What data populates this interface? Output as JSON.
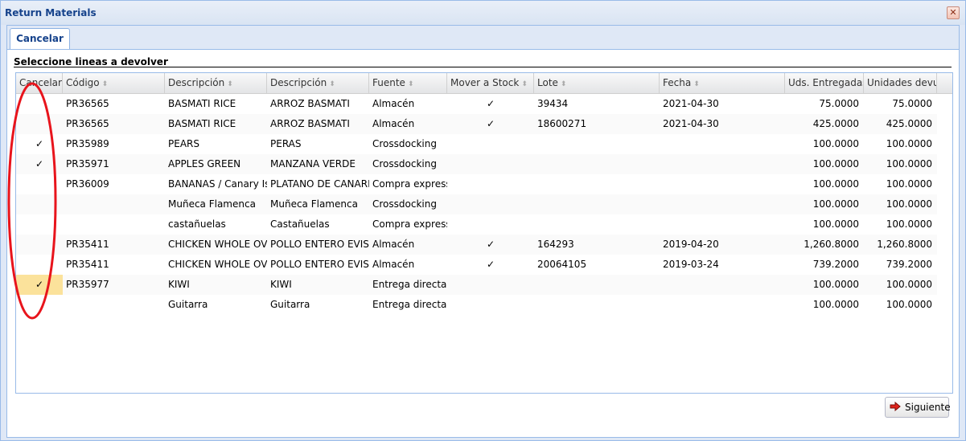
{
  "window": {
    "title": "Return Materials",
    "close_glyph": "✕"
  },
  "tabs": [
    {
      "label": "Cancelar"
    }
  ],
  "section": {
    "label": "Seleccione lineas a devolver"
  },
  "grid": {
    "columns": [
      {
        "label": "Cancelar"
      },
      {
        "label": "Código"
      },
      {
        "label": "Descripción"
      },
      {
        "label": "Descripción"
      },
      {
        "label": "Fuente"
      },
      {
        "label": "Mover a Stock"
      },
      {
        "label": "Lote"
      },
      {
        "label": "Fecha"
      },
      {
        "label": "Uds. Entregadas"
      },
      {
        "label": "Unidades devuel"
      }
    ],
    "rows": [
      {
        "cancel": "",
        "selected": false,
        "code": "PR36565",
        "desc_en": "BASMATI RICE",
        "desc_es": "ARROZ BASMATI",
        "source": "Almacén",
        "move_to_stock": "✓",
        "lot": "39434",
        "date": "2021-04-30",
        "delivered": "75.0000",
        "returned": "75.0000"
      },
      {
        "cancel": "",
        "selected": false,
        "code": "PR36565",
        "desc_en": "BASMATI RICE",
        "desc_es": "ARROZ BASMATI",
        "source": "Almacén",
        "move_to_stock": "✓",
        "lot": "18600271",
        "date": "2021-04-30",
        "delivered": "425.0000",
        "returned": "425.0000"
      },
      {
        "cancel": "✓",
        "selected": false,
        "code": "PR35989",
        "desc_en": "PEARS",
        "desc_es": "PERAS",
        "source": "Crossdocking",
        "move_to_stock": "",
        "lot": "",
        "date": "",
        "delivered": "100.0000",
        "returned": "100.0000"
      },
      {
        "cancel": "✓",
        "selected": false,
        "code": "PR35971",
        "desc_en": "APPLES GREEN",
        "desc_es": "MANZANA VERDE",
        "source": "Crossdocking",
        "move_to_stock": "",
        "lot": "",
        "date": "",
        "delivered": "100.0000",
        "returned": "100.0000"
      },
      {
        "cancel": "",
        "selected": false,
        "code": "PR36009",
        "desc_en": "BANANAS / Canary Isla",
        "desc_es": "PLATANO DE CANARIA",
        "source": "Compra express",
        "move_to_stock": "",
        "lot": "",
        "date": "",
        "delivered": "100.0000",
        "returned": "100.0000"
      },
      {
        "cancel": "",
        "selected": false,
        "code": "",
        "desc_en": "Muñeca Flamenca",
        "desc_es": "Muñeca Flamenca",
        "source": "Crossdocking",
        "move_to_stock": "",
        "lot": "",
        "date": "",
        "delivered": "100.0000",
        "returned": "100.0000"
      },
      {
        "cancel": "",
        "selected": false,
        "code": "",
        "desc_en": "castañuelas",
        "desc_es": "Castañuelas",
        "source": "Compra express",
        "move_to_stock": "",
        "lot": "",
        "date": "",
        "delivered": "100.0000",
        "returned": "100.0000"
      },
      {
        "cancel": "",
        "selected": false,
        "code": "PR35411",
        "desc_en": "CHICKEN WHOLE OVEN",
        "desc_es": "POLLO ENTERO EVISCE",
        "source": "Almacén",
        "move_to_stock": "✓",
        "lot": "164293",
        "date": "2019-04-20",
        "delivered": "1,260.8000",
        "returned": "1,260.8000"
      },
      {
        "cancel": "",
        "selected": false,
        "code": "PR35411",
        "desc_en": "CHICKEN WHOLE OVEN",
        "desc_es": "POLLO ENTERO EVISCE",
        "source": "Almacén",
        "move_to_stock": "✓",
        "lot": "20064105",
        "date": "2019-03-24",
        "delivered": "739.2000",
        "returned": "739.2000"
      },
      {
        "cancel": "✓",
        "selected": true,
        "code": "PR35977",
        "desc_en": "KIWI",
        "desc_es": "KIWI",
        "source": "Entrega directa",
        "move_to_stock": "",
        "lot": "",
        "date": "",
        "delivered": "100.0000",
        "returned": "100.0000"
      },
      {
        "cancel": "",
        "selected": false,
        "code": "",
        "desc_en": "Guitarra",
        "desc_es": "Guitarra",
        "source": "Entrega directa",
        "move_to_stock": "",
        "lot": "",
        "date": "",
        "delivered": "100.0000",
        "returned": "100.0000"
      }
    ]
  },
  "footer": {
    "next_label": "Siguiente",
    "next_icon": "red-arrow-right-icon"
  },
  "colors": {
    "title": "#15428b",
    "border": "#99bbe8",
    "selected_cell": "#fbe29b",
    "annotation": "#e8141c"
  }
}
